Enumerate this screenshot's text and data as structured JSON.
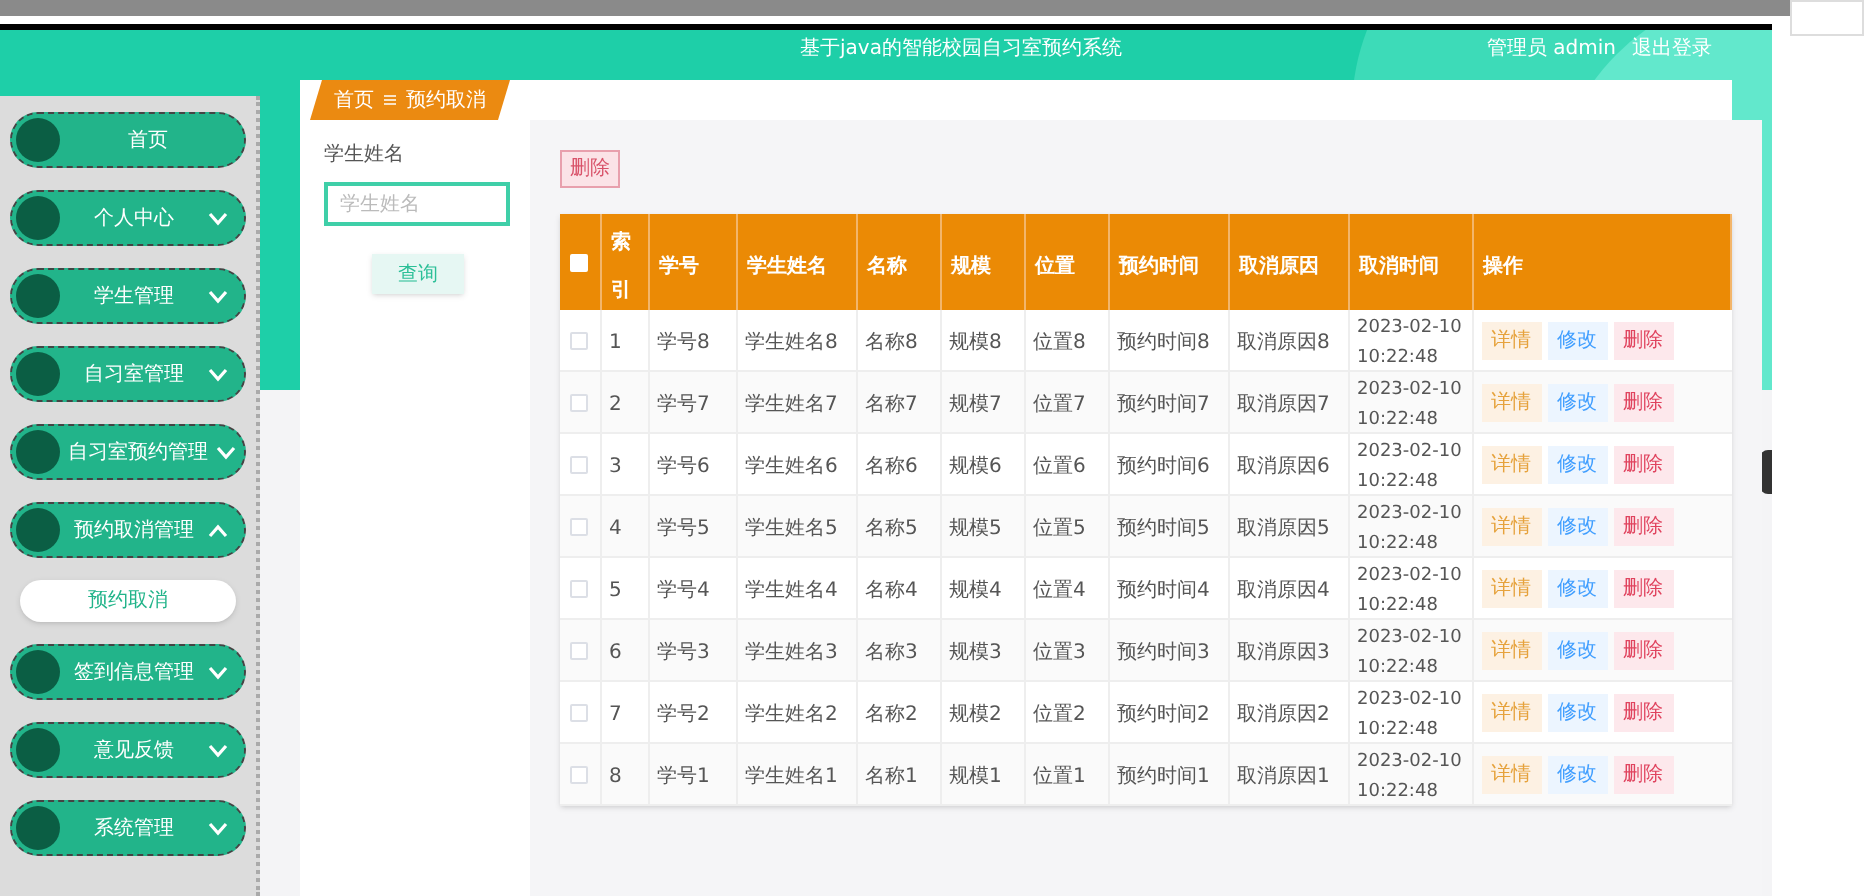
{
  "header": {
    "title": "基于java的智能校园自习室预约系统",
    "user": "管理员 admin",
    "logout": "退出登录"
  },
  "breadcrumb": [
    "首页",
    "预约取消"
  ],
  "sidebar": {
    "items": [
      {
        "label": "首页",
        "kind": "link"
      },
      {
        "label": "个人中心",
        "kind": "menu",
        "expanded": false
      },
      {
        "label": "学生管理",
        "kind": "menu",
        "expanded": false
      },
      {
        "label": "自习室管理",
        "kind": "menu",
        "expanded": false
      },
      {
        "label": "自习室预约管理",
        "kind": "menu",
        "expanded": false
      },
      {
        "label": "预约取消管理",
        "kind": "menu",
        "expanded": true,
        "children": [
          {
            "label": "预约取消",
            "selected": true
          }
        ]
      },
      {
        "label": "签到信息管理",
        "kind": "menu",
        "expanded": false
      },
      {
        "label": "意见反馈",
        "kind": "menu",
        "expanded": false
      },
      {
        "label": "系统管理",
        "kind": "menu",
        "expanded": false
      }
    ]
  },
  "search": {
    "label": "学生姓名",
    "placeholder": "学生姓名",
    "button": "查询"
  },
  "toolbar": {
    "delete": "删除"
  },
  "table": {
    "select_all_checked": false,
    "columns": [
      "索引",
      "学号",
      "学生姓名",
      "名称",
      "规模",
      "位置",
      "预约时间",
      "取消原因",
      "取消时间",
      "操作"
    ],
    "rows": [
      {
        "checked": false,
        "cells": [
          "1",
          "学号8",
          "学生姓名8",
          "名称8",
          "规模8",
          "位置8",
          "预约时间8",
          "取消原因8",
          "2023-02-10 10:22:48"
        ],
        "actions": [
          "详情",
          "修改",
          "删除"
        ]
      },
      {
        "checked": false,
        "cells": [
          "2",
          "学号7",
          "学生姓名7",
          "名称7",
          "规模7",
          "位置7",
          "预约时间7",
          "取消原因7",
          "2023-02-10 10:22:48"
        ],
        "actions": [
          "详情",
          "修改",
          "删除"
        ]
      },
      {
        "checked": false,
        "cells": [
          "3",
          "学号6",
          "学生姓名6",
          "名称6",
          "规模6",
          "位置6",
          "预约时间6",
          "取消原因6",
          "2023-02-10 10:22:48"
        ],
        "actions": [
          "详情",
          "修改",
          "删除"
        ]
      },
      {
        "checked": false,
        "cells": [
          "4",
          "学号5",
          "学生姓名5",
          "名称5",
          "规模5",
          "位置5",
          "预约时间5",
          "取消原因5",
          "2023-02-10 10:22:48"
        ],
        "actions": [
          "详情",
          "修改",
          "删除"
        ]
      },
      {
        "checked": false,
        "cells": [
          "5",
          "学号4",
          "学生姓名4",
          "名称4",
          "规模4",
          "位置4",
          "预约时间4",
          "取消原因4",
          "2023-02-10 10:22:48"
        ],
        "actions": [
          "详情",
          "修改",
          "删除"
        ]
      },
      {
        "checked": false,
        "cells": [
          "6",
          "学号3",
          "学生姓名3",
          "名称3",
          "规模3",
          "位置3",
          "预约时间3",
          "取消原因3",
          "2023-02-10 10:22:48"
        ],
        "actions": [
          "详情",
          "修改",
          "删除"
        ]
      },
      {
        "checked": false,
        "cells": [
          "7",
          "学号2",
          "学生姓名2",
          "名称2",
          "规模2",
          "位置2",
          "预约时间2",
          "取消原因2",
          "2023-02-10 10:22:48"
        ],
        "actions": [
          "详情",
          "修改",
          "删除"
        ]
      },
      {
        "checked": false,
        "cells": [
          "8",
          "学号1",
          "学生姓名1",
          "名称1",
          "规模1",
          "位置1",
          "预约时间1",
          "取消原因1",
          "2023-02-10 10:22:48"
        ],
        "actions": [
          "详情",
          "修改",
          "删除"
        ]
      }
    ]
  }
}
